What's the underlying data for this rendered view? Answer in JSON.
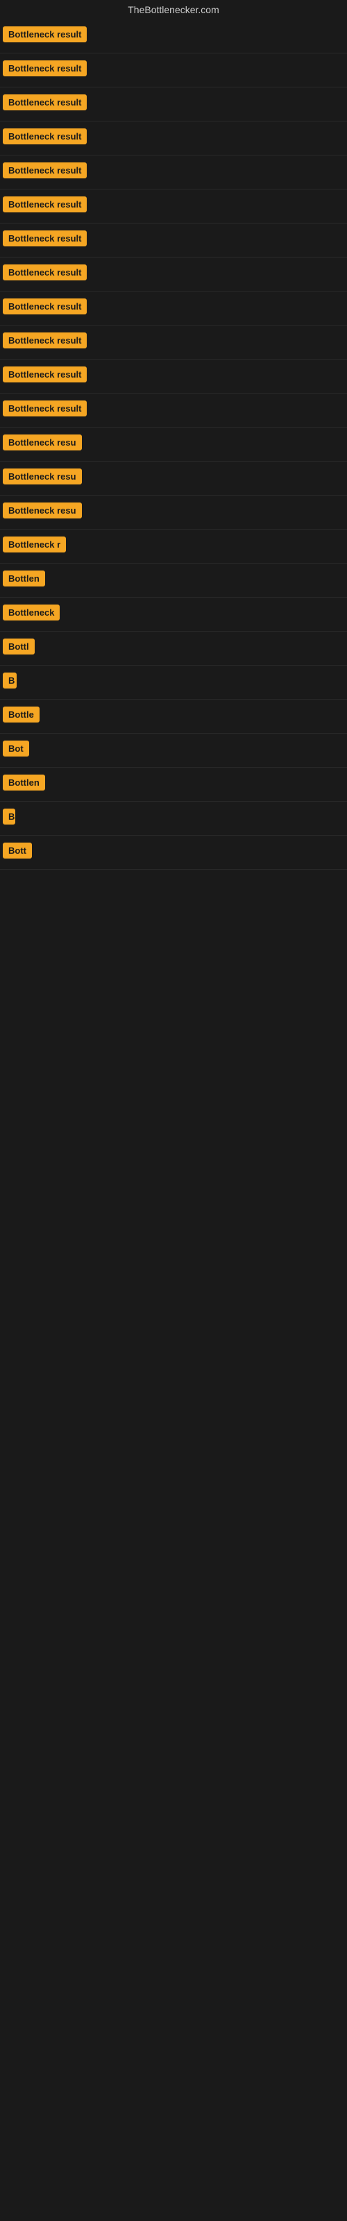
{
  "site": {
    "title": "TheBottlenecker.com"
  },
  "results": [
    {
      "label": "Bottleneck result",
      "width": 160
    },
    {
      "label": "Bottleneck result",
      "width": 160
    },
    {
      "label": "Bottleneck result",
      "width": 160
    },
    {
      "label": "Bottleneck result",
      "width": 160
    },
    {
      "label": "Bottleneck result",
      "width": 160
    },
    {
      "label": "Bottleneck result",
      "width": 160
    },
    {
      "label": "Bottleneck result",
      "width": 160
    },
    {
      "label": "Bottleneck result",
      "width": 160
    },
    {
      "label": "Bottleneck result",
      "width": 160
    },
    {
      "label": "Bottleneck result",
      "width": 160
    },
    {
      "label": "Bottleneck result",
      "width": 160
    },
    {
      "label": "Bottleneck result",
      "width": 155
    },
    {
      "label": "Bottleneck resu",
      "width": 145
    },
    {
      "label": "Bottleneck resu",
      "width": 140
    },
    {
      "label": "Bottleneck resu",
      "width": 135
    },
    {
      "label": "Bottleneck r",
      "width": 110
    },
    {
      "label": "Bottlen",
      "width": 80
    },
    {
      "label": "Bottleneck",
      "width": 95
    },
    {
      "label": "Bottl",
      "width": 65
    },
    {
      "label": "B",
      "width": 20
    },
    {
      "label": "Bottle",
      "width": 70
    },
    {
      "label": "Bot",
      "width": 45
    },
    {
      "label": "Bottlen",
      "width": 78
    },
    {
      "label": "B",
      "width": 18
    },
    {
      "label": "Bott",
      "width": 55
    }
  ]
}
